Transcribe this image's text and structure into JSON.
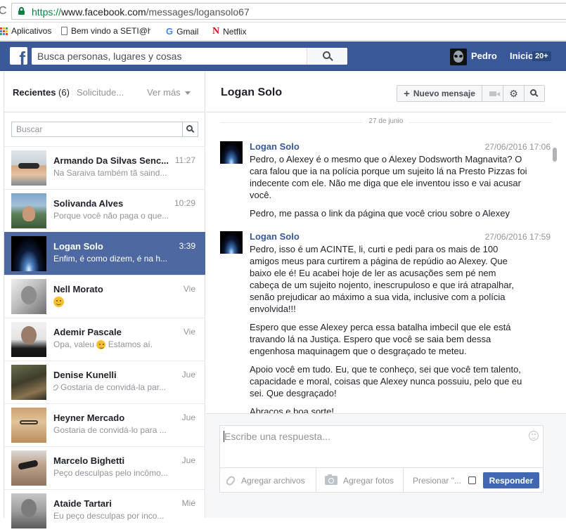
{
  "browser": {
    "url_scheme": "https://",
    "url_host": "www.facebook.com",
    "url_path": "/messages/logansolo67",
    "bookmarks": [
      {
        "label": "Aplicativos",
        "icon": "apps-grid-icon"
      },
      {
        "label": "Bem vindo a SETI@hc",
        "icon": "page-icon"
      },
      {
        "label": "Gmail",
        "icon": "google-g-icon"
      },
      {
        "label": "Netflix",
        "icon": "netflix-n-icon"
      }
    ]
  },
  "topbar": {
    "logo": "f",
    "search_placeholder": "Busca personas, lugares y cosas",
    "user_name": "Pedro",
    "home_label": "Inicio",
    "home_badge": "20+",
    "brand_color": "#3b5998"
  },
  "sidebar": {
    "recent_label": "Recientes",
    "recent_count": "(6)",
    "requests_label": "Solicitude...",
    "more_label": "Ver más",
    "search_placeholder": "Buscar",
    "conversations": [
      {
        "name": "Armando Da Silvas Senc...",
        "time": "11:27",
        "snippet": "Na Saraiva também tã saind...",
        "selected": false
      },
      {
        "name": "Solivanda Alves",
        "time": "10:29",
        "snippet": "Porque você não paga o que...",
        "selected": false
      },
      {
        "name": "Logan Solo",
        "time": "3:39",
        "snippet": "Enfim, é como dizem, é na h...",
        "selected": true
      },
      {
        "name": "Nell Morato",
        "time": "Vie",
        "snippet": "",
        "selected": false
      },
      {
        "name": "Ademir Pascale",
        "time": "Vie",
        "snippet": "Opa, valeu",
        "snippet2": "Estamos aí.",
        "selected": false
      },
      {
        "name": "Denise Kunelli",
        "time": "Jue",
        "snippet": "Gostaria de convidá-la par...",
        "selected": false
      },
      {
        "name": "Heyner Mercado",
        "time": "Jue",
        "snippet": "Gostaria de convidá-lo para ...",
        "selected": false
      },
      {
        "name": "Marcelo Bighetti",
        "time": "Jue",
        "snippet": "Peço desculpas pelo incômo...",
        "selected": false
      },
      {
        "name": "Ataide Tartari",
        "time": "Mié",
        "snippet": "Eu peço desculpas por inco...",
        "selected": false
      }
    ]
  },
  "thread": {
    "title": "Logan Solo",
    "new_message_label": "Nuevo mensaje",
    "date_separator": "27 de junio",
    "messages": [
      {
        "author": "Logan Solo",
        "timestamp": "27/06/2016 17:06",
        "paragraphs": [
          "Pedro, o Alexey é o mesmo que o Alexey Dodsworth Magnavita? O cara falou que ia na polícia porque um sujeito lá na Presto Pizzas foi indecente com ele. Não me diga que ele inventou isso e vai acusar você.",
          "Pedro, me passa o link da página que você criou sobre o Alexey"
        ]
      },
      {
        "author": "Logan Solo",
        "timestamp": "27/06/2016 17:59",
        "paragraphs": [
          "Pedro, isso é um ACINTE, li, curti e pedi para os mais de 100 amigos meus para curtirem a página de repúdio ao Alexey. Que baixo ele é! Eu acabei hoje de ler as acusações sem pé nem cabeça de um sujeito nojento, inescrupuloso e que irá atrapalhar, senão prejudicar ao máximo a sua vida, inclusive com a polícia envolvida!!!",
          "Espero que esse Alexey perca essa batalha imbecil que ele está travando lá na Justiça. Espero que você se saia bem dessa engenhosa maquinagem que o desgraçado te meteu.",
          "Apoio você em tudo. Eu, que te conheço, sei que você tem talento, capacidade e moral, coisas que Alexey nunca possuiu, pelo que eu sei. Que desgraçado!",
          "Abraços e boa sorte!"
        ]
      }
    ]
  },
  "composer": {
    "placeholder": "Escribe una respuesta...",
    "attach_label": "Agregar archivos",
    "photos_label": "Agregar fotos",
    "enter_label": "Presionar \"...",
    "send_label": "Responder"
  }
}
